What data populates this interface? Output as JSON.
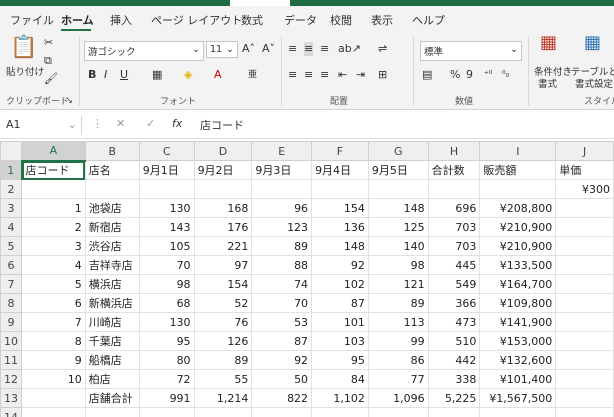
{
  "menu": {
    "tabs": [
      "ファイル",
      "ホーム",
      "挿入",
      "ページ レイアウト",
      "数式",
      "データ",
      "校閲",
      "表示",
      "ヘルプ"
    ],
    "active_index": 1
  },
  "ribbon": {
    "clipboard": {
      "paste_label": "貼り付け",
      "group_label": "クリップボード"
    },
    "font": {
      "font_name": "游ゴシック",
      "font_size": "11",
      "group_label": "フォント"
    },
    "alignment": {
      "group_label": "配置"
    },
    "number": {
      "format": "標準",
      "group_label": "数値"
    },
    "styles": {
      "conditional_label": "条件付き",
      "conditional_label2": "書式",
      "table_label": "テーブルとし",
      "table_label2": "書式設定",
      "group_label": "スタイル"
    }
  },
  "formula_bar": {
    "name_box": "A1",
    "fx": "fx",
    "content": "店コード"
  },
  "columns": [
    "A",
    "B",
    "C",
    "D",
    "E",
    "F",
    "G",
    "H",
    "I",
    "J"
  ],
  "rows": [
    [
      "店コード",
      "店名",
      "9月1日",
      "9月2日",
      "9月3日",
      "9月4日",
      "9月5日",
      "合計数",
      "販売額",
      "単価"
    ],
    [
      "",
      "",
      "",
      "",
      "",
      "",
      "",
      "",
      "",
      "¥300"
    ],
    [
      "1",
      "池袋店",
      "130",
      "168",
      "96",
      "154",
      "148",
      "696",
      "¥208,800",
      ""
    ],
    [
      "2",
      "新宿店",
      "143",
      "176",
      "123",
      "136",
      "125",
      "703",
      "¥210,900",
      ""
    ],
    [
      "3",
      "渋谷店",
      "105",
      "221",
      "89",
      "148",
      "140",
      "703",
      "¥210,900",
      ""
    ],
    [
      "4",
      "吉祥寺店",
      "70",
      "97",
      "88",
      "92",
      "98",
      "445",
      "¥133,500",
      ""
    ],
    [
      "5",
      "横浜店",
      "98",
      "154",
      "74",
      "102",
      "121",
      "549",
      "¥164,700",
      ""
    ],
    [
      "6",
      "新横浜店",
      "68",
      "52",
      "70",
      "87",
      "89",
      "366",
      "¥109,800",
      ""
    ],
    [
      "7",
      "川崎店",
      "130",
      "76",
      "53",
      "101",
      "113",
      "473",
      "¥141,900",
      ""
    ],
    [
      "8",
      "千葉店",
      "95",
      "126",
      "87",
      "103",
      "99",
      "510",
      "¥153,000",
      ""
    ],
    [
      "9",
      "船橋店",
      "80",
      "89",
      "92",
      "95",
      "86",
      "442",
      "¥132,600",
      ""
    ],
    [
      "10",
      "柏店",
      "72",
      "55",
      "50",
      "84",
      "77",
      "338",
      "¥101,400",
      ""
    ],
    [
      "",
      "店舗合計",
      "991",
      "1,214",
      "822",
      "1,102",
      "1,096",
      "5,225",
      "¥1,567,500",
      ""
    ],
    [
      "",
      "",
      "",
      "",
      "",
      "",
      "",
      "",
      "",
      ""
    ]
  ],
  "accent": "#217346"
}
